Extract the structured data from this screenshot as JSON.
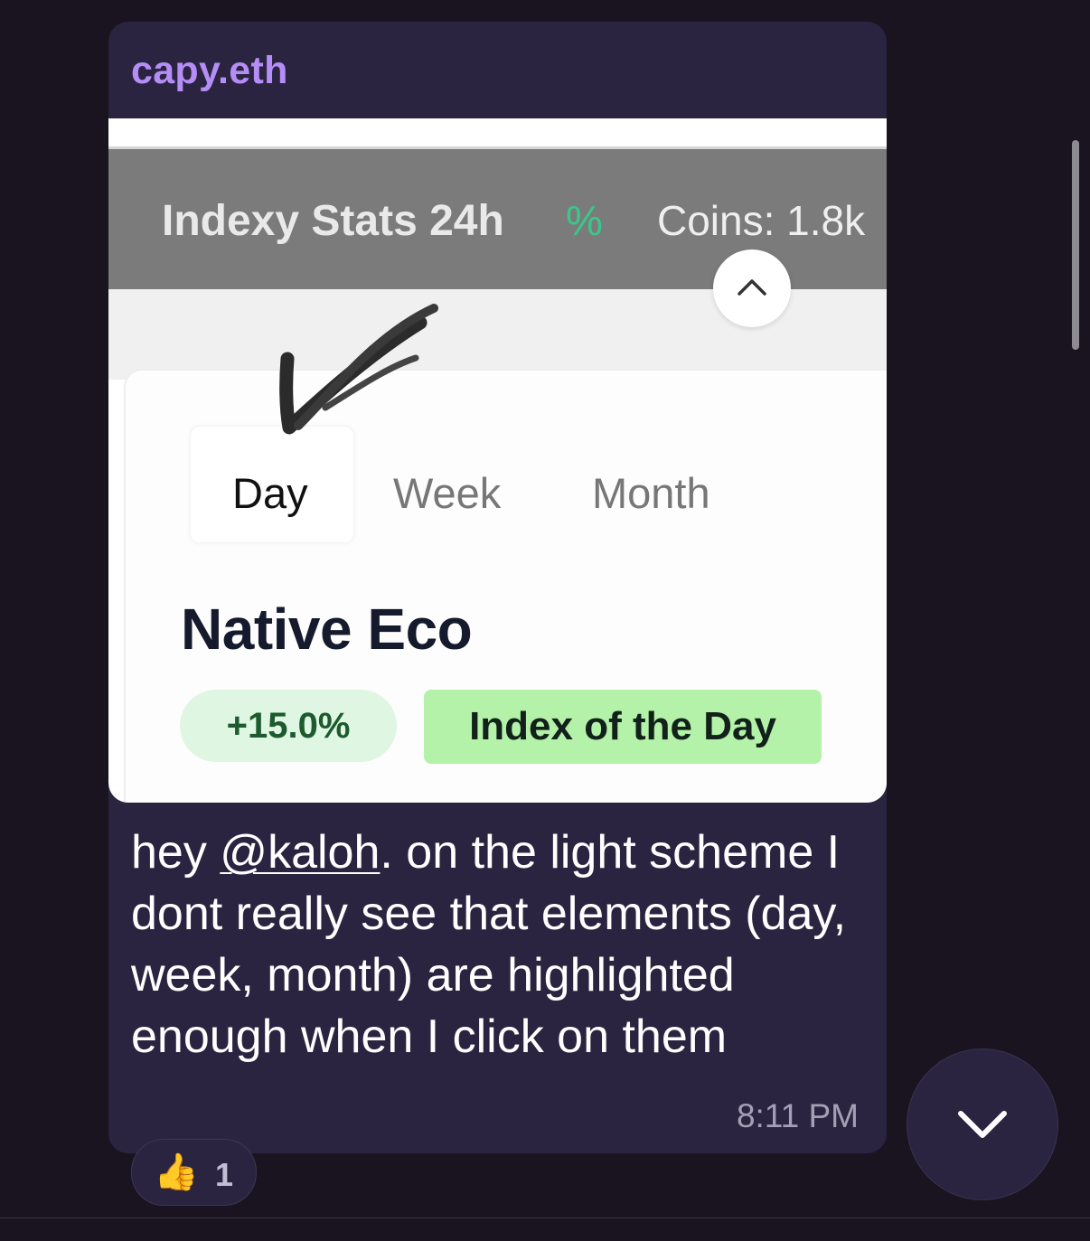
{
  "message": {
    "sender": "capy.eth",
    "text_before_mention": "hey ",
    "mention": "@kaloh",
    "text_after_mention": ". on the light scheme I dont really see that elements (day, week, month) are highlighted enough when I click on them",
    "timestamp": "8:11 PM"
  },
  "attachment": {
    "stats_title": "Indexy Stats 24h",
    "stats_pct_symbol": "%",
    "stats_coins": "Coins: 1.8k",
    "tabs": [
      {
        "label": "Day",
        "selected": true
      },
      {
        "label": "Week",
        "selected": false
      },
      {
        "label": "Month",
        "selected": false
      }
    ],
    "index_name": "Native Eco",
    "change": "+15.0%",
    "badge": "Index of the Day",
    "colors": {
      "change_bg": "#dff6e2",
      "badge_bg": "#b3f2a8",
      "pct_accent": "#38c98a"
    }
  },
  "reaction": {
    "emoji": "👍",
    "count": "1"
  },
  "icons": {
    "collapse": "chevron-up-icon",
    "scroll_down": "chevron-down-icon",
    "annotation": "checkmark-scribble-icon"
  },
  "colors": {
    "background": "#19141f",
    "bubble": "#2b2440",
    "sender": "#b58df7"
  }
}
